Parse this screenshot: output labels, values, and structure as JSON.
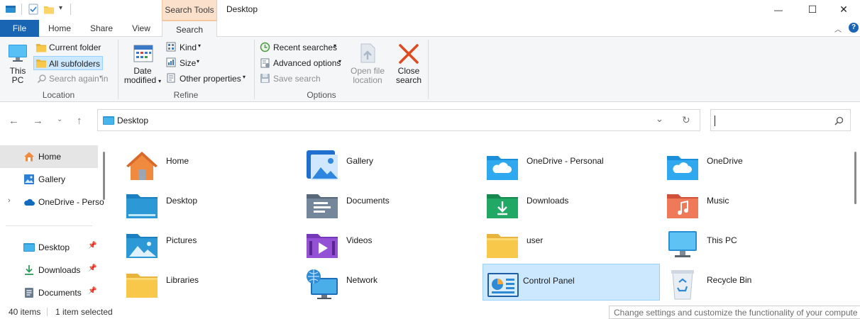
{
  "title_bar": {
    "context_tab_label": "Search Tools",
    "window_title": "Desktop",
    "minimize_glyph": "—",
    "maximize_glyph": "☐",
    "close_glyph": "✕"
  },
  "ribbon_tabs": [
    "File",
    "Home",
    "Share",
    "View",
    "Search"
  ],
  "ribbon": {
    "location": {
      "this_pc_line1": "This",
      "this_pc_line2": "PC",
      "current_folder": "Current folder",
      "all_subfolders": "All subfolders",
      "search_again_in": "Search again in",
      "group_label": "Location"
    },
    "refine": {
      "date_line1": "Date",
      "date_line2": "modified",
      "kind": "Kind",
      "size": "Size",
      "other_properties": "Other properties",
      "group_label": "Refine"
    },
    "options": {
      "recent_searches": "Recent searches",
      "advanced_options": "Advanced options",
      "save_search": "Save search",
      "open_file_line1": "Open file",
      "open_file_line2": "location",
      "close_line1": "Close",
      "close_line2": "search",
      "group_label": "Options"
    }
  },
  "address": {
    "path": "Desktop"
  },
  "nav_pane": {
    "items": [
      "Home",
      "Gallery",
      "OneDrive - Perso",
      "Desktop",
      "Downloads",
      "Documents"
    ]
  },
  "content": {
    "items": [
      "Home",
      "Gallery",
      "OneDrive - Personal",
      "OneDrive",
      "Desktop",
      "Documents",
      "Downloads",
      "Music",
      "Pictures",
      "Videos",
      "user",
      "This PC",
      "Libraries",
      "Network",
      "Control Panel",
      "Recycle Bin"
    ],
    "selected": "Control Panel"
  },
  "status_bar": {
    "item_count": "40 items",
    "selection": "1 item selected",
    "tooltip": "Change settings and customize the functionality of your compute"
  },
  "colors": {
    "file_tab": "#1a64b4",
    "context_tab": "#fbe1cb",
    "selection_fill": "#cce8ff",
    "folder_yellow": "#f8c84a"
  }
}
